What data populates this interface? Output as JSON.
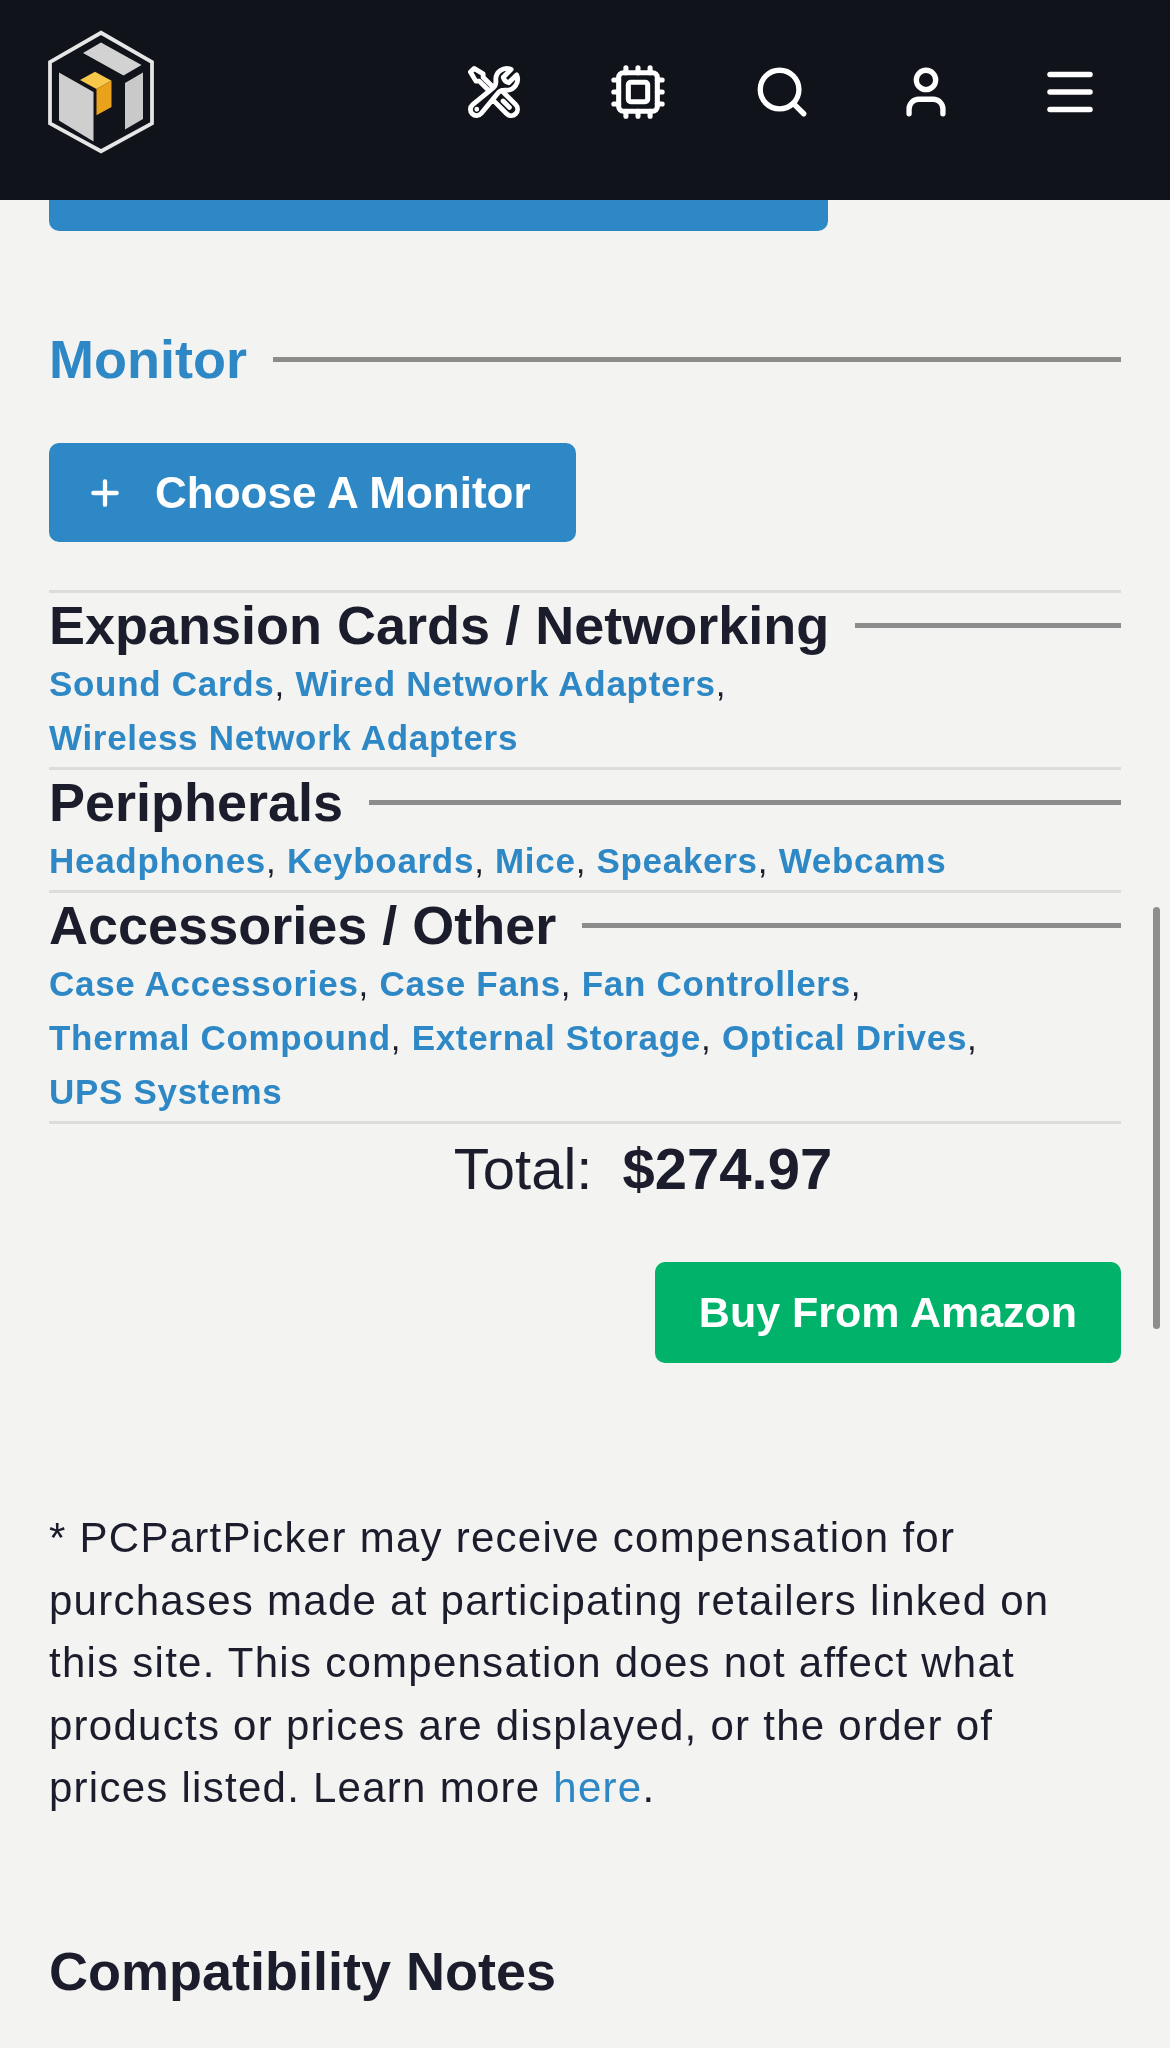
{
  "monitor": {
    "title": "Monitor",
    "button_label": "Choose A Monitor"
  },
  "categories": [
    {
      "title": "Expansion Cards / Networking",
      "links": [
        "Sound Cards",
        "Wired Network Adapters",
        "Wireless Network Adapters"
      ]
    },
    {
      "title": "Peripherals",
      "links": [
        "Headphones",
        "Keyboards",
        "Mice",
        "Speakers",
        "Webcams"
      ]
    },
    {
      "title": "Accessories / Other",
      "links": [
        "Case Accessories",
        "Case Fans",
        "Fan Controllers",
        "Thermal Compound",
        "External Storage",
        "Optical Drives",
        "UPS Systems"
      ]
    }
  ],
  "link_separator": ",",
  "total": {
    "label": "Total:",
    "amount": "$274.97"
  },
  "buy_button": {
    "label": "Buy From Amazon"
  },
  "disclaimer": {
    "text": "* PCPartPicker may receive compensation for purchases made at participating retailers linked on this site. This compensation does not affect what products or prices are displayed, or the order of prices listed. Learn more",
    "link": "here",
    "end": "."
  },
  "compatibility_notes": {
    "title": "Compatibility Notes"
  }
}
